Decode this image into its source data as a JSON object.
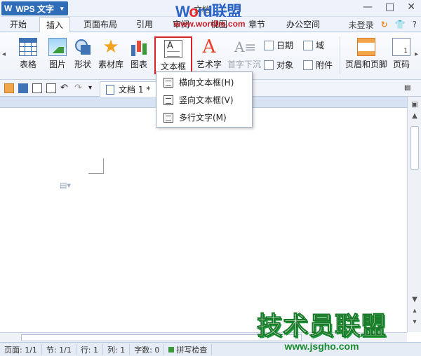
{
  "titlebar": {
    "app_label": "WPS 文字",
    "app_icon": "W",
    "doc_title": "文档",
    "controls": [
      "—",
      "□",
      "✕"
    ]
  },
  "watermark_top": {
    "w": "W",
    "o": "o",
    "rd": "rd",
    "cn": "联盟",
    "url": "www.wordlm.com"
  },
  "menu": {
    "tabs": [
      "开始",
      "插入",
      "页面布局",
      "引用",
      "审阅",
      "视图",
      "章节",
      "办公空间"
    ],
    "active": "插入",
    "login": "未登录",
    "help": "?"
  },
  "ribbon": {
    "table": "表格",
    "picture": "图片",
    "shape": "形状",
    "clipart": "素材库",
    "chart": "图表",
    "textbox": "文本框",
    "wordart": "艺术字",
    "dropcap": "首字下沉",
    "date": "日期",
    "field": "域",
    "object": "对象",
    "attachment": "附件",
    "header_footer": "页眉和页脚",
    "page_number": "页码"
  },
  "doc_tab": {
    "label": "文档 1 *"
  },
  "dropdown": {
    "items": [
      "横向文本框(H)",
      "竖向文本框(V)",
      "多行文字(M)"
    ]
  },
  "status": {
    "page": "页面: 1/1",
    "section": "节: 1/1",
    "row": "行: 1",
    "col": "列: 1",
    "words": "字数: 0",
    "spell": "拼写检查"
  },
  "watermark_bottom": {
    "title": "技术员联盟",
    "url": "www.jsgho.com"
  }
}
